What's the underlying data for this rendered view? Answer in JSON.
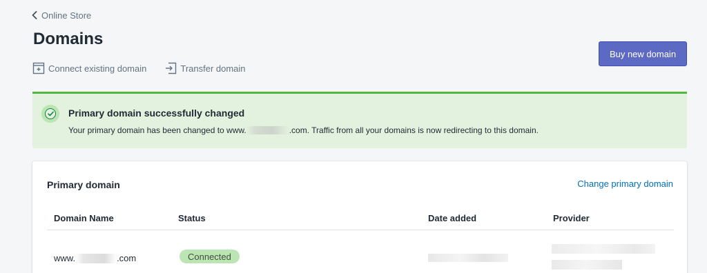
{
  "breadcrumb": {
    "label": "Online Store"
  },
  "page": {
    "title": "Domains"
  },
  "actions": {
    "connect_label": "Connect existing domain",
    "transfer_label": "Transfer domain",
    "buy_label": "Buy new domain"
  },
  "banner": {
    "title": "Primary domain successfully changed",
    "text_before": "Your primary domain has been changed to www.",
    "text_after": ".com. Traffic from all your domains is now redirecting to this domain."
  },
  "card": {
    "title": "Primary domain",
    "action_label": "Change primary domain",
    "columns": [
      "Domain Name",
      "Status",
      "Date added",
      "Provider"
    ],
    "rows": [
      {
        "domain_prefix": "www.",
        "domain_suffix": ".com",
        "status": "Connected"
      }
    ]
  },
  "colors": {
    "primary_button": "#5c6ac4",
    "success_banner": "#e3f1df",
    "success_border": "#50b83c",
    "badge_bg": "#bbe5b3",
    "link": "#006fbb"
  },
  "icons": {
    "back": "chevron-left-icon",
    "connect": "connect-domain-icon",
    "transfer": "transfer-icon",
    "success": "checkmark-circle-icon"
  }
}
